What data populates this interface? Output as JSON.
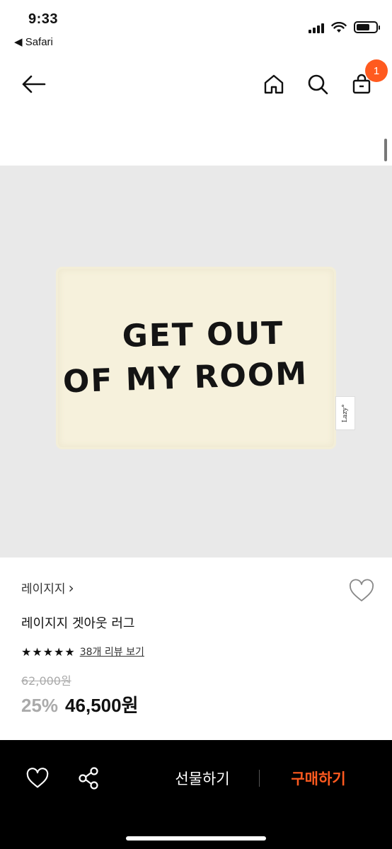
{
  "status_bar": {
    "time": "9:33",
    "back_app": "◀ Safari"
  },
  "nav": {
    "cart_count": "1"
  },
  "product_image": {
    "rug_line1": "GET OUT",
    "rug_line2": "OF MY ROOM",
    "tag_text": "Lazy°"
  },
  "product": {
    "brand": "레이지지",
    "brand_chevron": "›",
    "name": "레이지지 겟아웃 러그",
    "stars": "★★★★★",
    "rating_value": 5,
    "review_link": "38개 리뷰 보기",
    "original_price": "62,000원",
    "discount": "25%",
    "sale_price": "46,500원"
  },
  "bottom_bar": {
    "gift_label": "선물하기",
    "buy_label": "구매하기"
  },
  "colors": {
    "accent": "#ff5a1f",
    "image_bg": "#e9e9e9",
    "bottom_bg": "#000000"
  },
  "icons": {
    "back": "arrow-left-icon",
    "home": "home-icon",
    "search": "search-icon",
    "cart": "shopping-bag-icon",
    "wishlist": "heart-icon",
    "share": "share-icon"
  }
}
